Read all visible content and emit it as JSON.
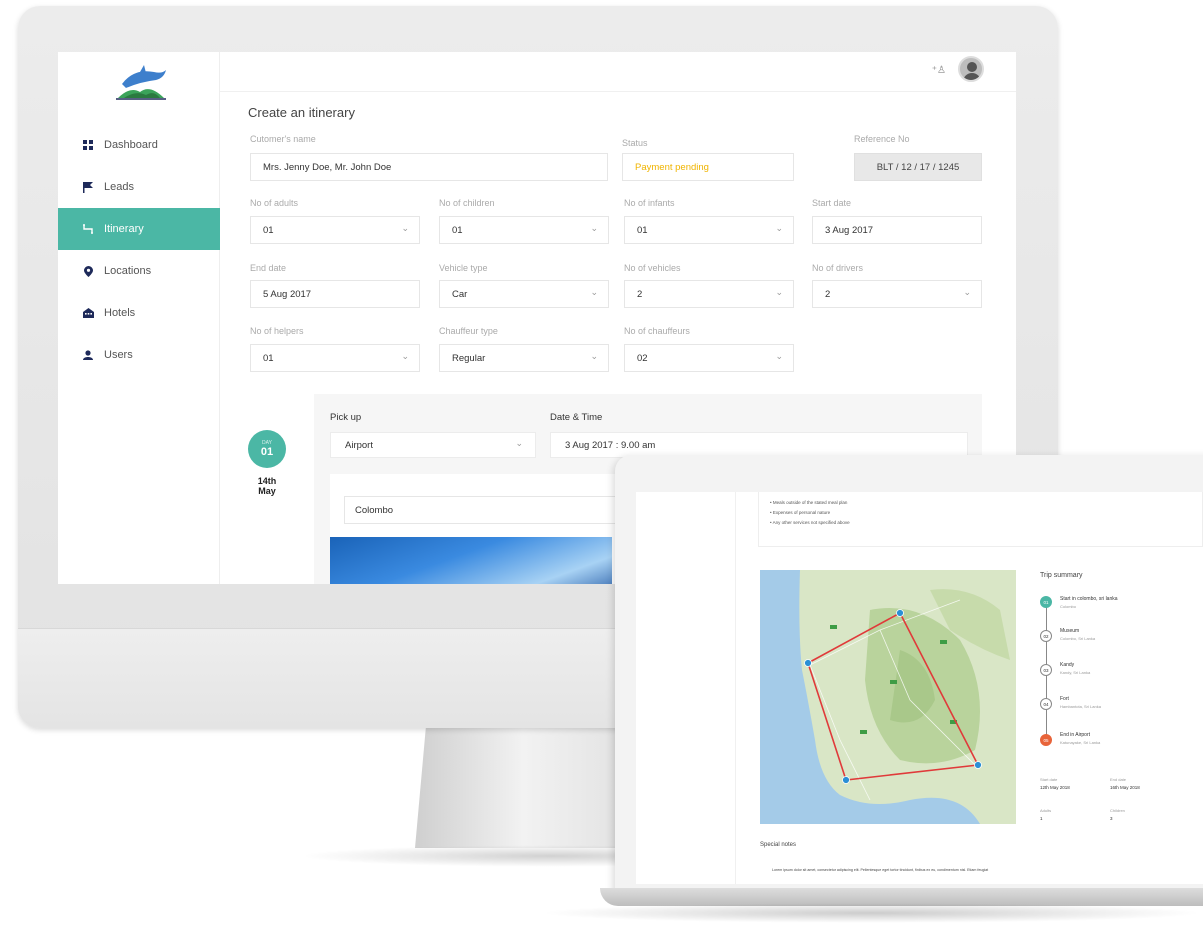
{
  "sidebar": {
    "items": [
      {
        "label": "Dashboard",
        "icon": "grid-icon"
      },
      {
        "label": "Leads",
        "icon": "flag-icon"
      },
      {
        "label": "Itinerary",
        "icon": "route-icon"
      },
      {
        "label": "Locations",
        "icon": "map-pin-icon"
      },
      {
        "label": "Hotels",
        "icon": "building-icon"
      },
      {
        "label": "Users",
        "icon": "user-icon"
      }
    ]
  },
  "page": {
    "title": "Create an itinerary"
  },
  "form": {
    "customer_label": "Cutomer's name",
    "customer_value": "Mrs. Jenny Doe, Mr. John Doe",
    "status_label": "Status",
    "status_value": "Payment pending",
    "ref_label": "Reference No",
    "ref_value": "BLT / 12 / 17 / 1245",
    "adults_label": "No of adults",
    "adults_value": "01",
    "children_label": "No of children",
    "children_value": "01",
    "infants_label": "No of infants",
    "infants_value": "01",
    "start_label": "Start date",
    "start_value": "3 Aug 2017",
    "end_label": "End date",
    "end_value": "5 Aug 2017",
    "vehicle_label": "Vehicle type",
    "vehicle_value": "Car",
    "vehicles_label": "No of vehicles",
    "vehicles_value": "2",
    "drivers_label": "No of drivers",
    "drivers_value": "2",
    "helpers_label": "No of helpers",
    "helpers_value": "01",
    "chauffeur_type_label": "Chauffeur type",
    "chauffeur_type_value": "Regular",
    "chauffeurs_label": "No of chauffeurs",
    "chauffeurs_value": "02"
  },
  "day": {
    "badge_label": "DAY",
    "badge_num": "01",
    "date_line1": "14th",
    "date_line2": "May",
    "pickup_label": "Pick up",
    "pickup_value": "Airport",
    "datetime_label": "Date & Time",
    "datetime_value": "3 Aug 2017 : 9.00 am",
    "location_value": "Colombo"
  },
  "laptop": {
    "exclusions": [
      "Meals outside of the stated meal plan",
      "Expenses of personal nature",
      "Any other services not specified above"
    ],
    "trip_title": "Trip summary",
    "stops": [
      {
        "num": "01",
        "name": "Start in colombo, sri lanka",
        "sub": "Colombo"
      },
      {
        "num": "02",
        "name": "Museum",
        "sub": "Colombo, Sri Lanka"
      },
      {
        "num": "03",
        "name": "Kandy",
        "sub": "Kandy, Sri Lanka"
      },
      {
        "num": "04",
        "name": "Fort",
        "sub": "Hambantota, Sri Lanka"
      },
      {
        "num": "05",
        "name": "End in Airport",
        "sub": "Katunayake, Sri Lanka"
      }
    ],
    "summary": {
      "start_label": "Start date",
      "start_value": "12th May 2018",
      "end_label": "End date",
      "end_value": "16th May 2018",
      "adults_label": "Adults",
      "adults_value": "1",
      "children_label": "Children",
      "children_value": "3"
    },
    "special_title": "Special notes",
    "special_text": "Lorem ipsum dolor sit amet, consectetur adipiscing elit. Pellentesque eget tortor tincidunt, finibus ex eu, condimentum nisl. Etiam feugiat"
  },
  "colors": {
    "accent": "#4bb7a5",
    "warning": "#f0b400",
    "end_stop": "#e8643a",
    "route": "#e03a3a"
  }
}
